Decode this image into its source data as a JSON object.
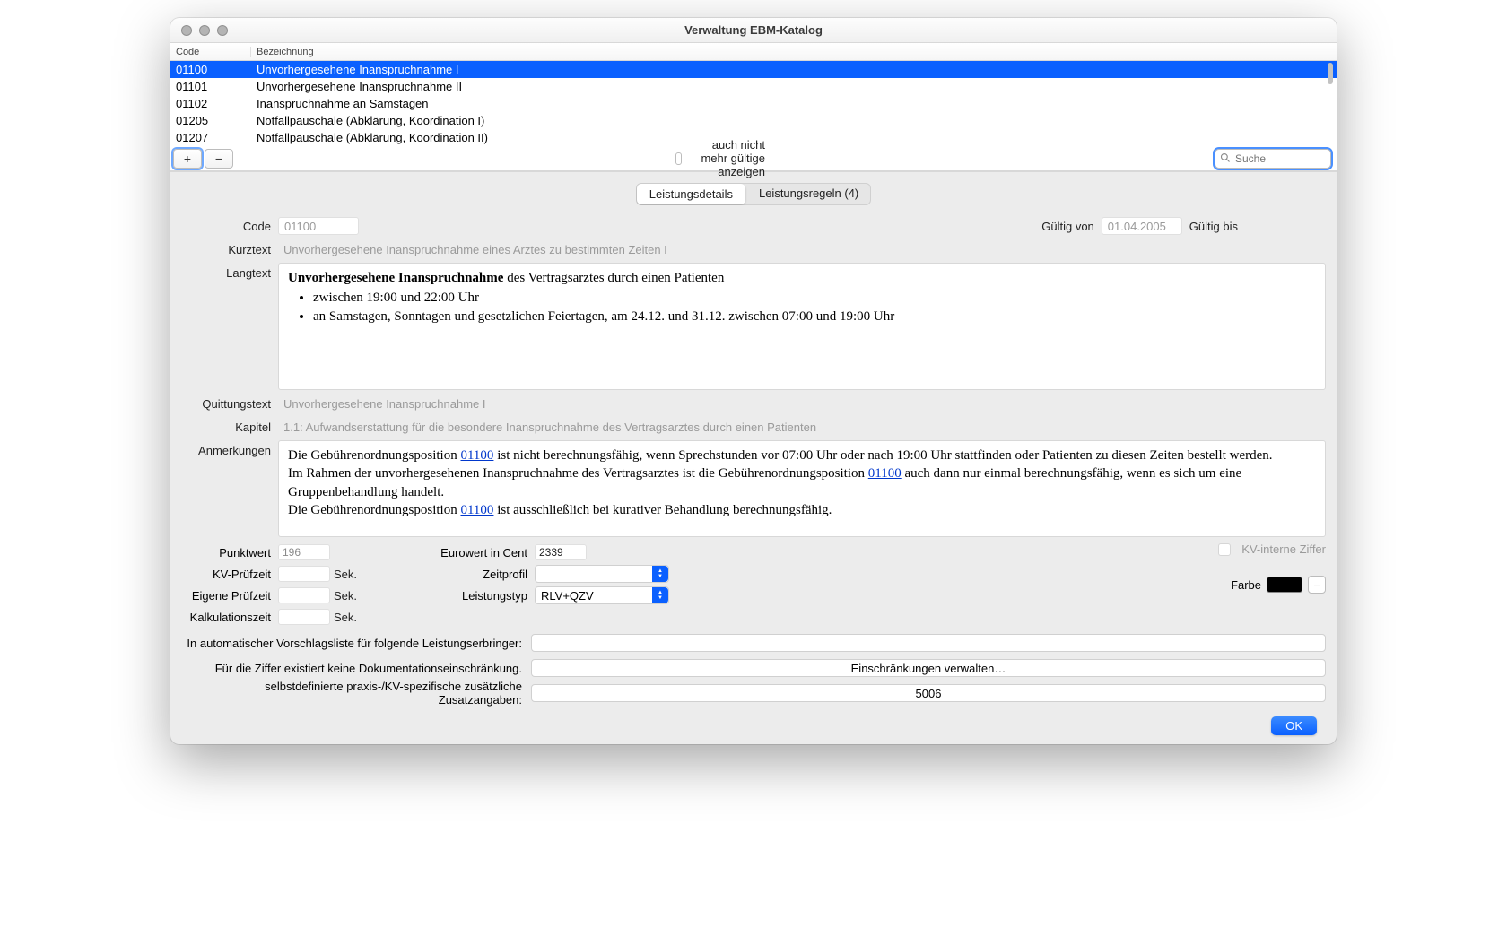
{
  "window": {
    "title": "Verwaltung EBM-Katalog"
  },
  "table": {
    "cols": {
      "code": "Code",
      "desc": "Bezeichnung"
    },
    "rows": [
      {
        "code": "01100",
        "desc": "Unvorhergesehene Inanspruchnahme I",
        "selected": true
      },
      {
        "code": "01101",
        "desc": "Unvorhergesehene Inanspruchnahme II"
      },
      {
        "code": "01102",
        "desc": "Inanspruchnahme an Samstagen"
      },
      {
        "code": "01205",
        "desc": "Notfallpauschale (Abklärung, Koordination I)"
      },
      {
        "code": "01207",
        "desc": "Notfallpauschale (Abklärung, Koordination II)"
      }
    ]
  },
  "toolbar": {
    "add": "+",
    "remove": "−",
    "also_invalid_label": "auch nicht mehr gültige anzeigen",
    "search_placeholder": "Suche"
  },
  "tabs": {
    "details": "Leistungsdetails",
    "rules": "Leistungsregeln (4)"
  },
  "details": {
    "labels": {
      "code": "Code",
      "valid_from": "Gültig von",
      "valid_to": "Gültig bis",
      "kurztext": "Kurztext",
      "langtext": "Langtext",
      "quittungstext": "Quittungstext",
      "kapitel": "Kapitel",
      "anmerkungen": "Anmerkungen",
      "punktwert": "Punktwert",
      "eurowert": "Eurowert in Cent",
      "kv_pruef": "KV-Prüfzeit",
      "eigene_pruef": "Eigene Prüfzeit",
      "kalk": "Kalkulationszeit",
      "zeitprofil": "Zeitprofil",
      "leistungstyp": "Leistungstyp",
      "kv_intern": "KV-interne Ziffer",
      "farbe": "Farbe",
      "sek": "Sek.",
      "auto_list": "In automatischer Vorschlagsliste für folgende Leistungserbringer:",
      "doc_restrict": "Für die Ziffer existiert keine Dokumentationseinschränkung.",
      "restrict_btn": "Einschränkungen verwalten…",
      "extra": "selbstdefinierte praxis-/KV-spezifische zusätzliche Zusatzangaben:"
    },
    "values": {
      "code": "01100",
      "valid_from": "01.04.2005",
      "valid_to": "",
      "kurztext": "Unvorhergesehene Inanspruchnahme eines Arztes zu bestimmten Zeiten I",
      "langtext_strong": "Unvorhergesehene Inanspruchnahme",
      "langtext_rest": " des Vertragsarztes durch einen Patienten",
      "langtext_b1": "zwischen 19:00 und 22:00 Uhr",
      "langtext_b2": "an Samstagen, Sonntagen und gesetzlichen Feiertagen, am 24.12. und 31.12. zwischen 07:00 und 19:00 Uhr",
      "quittungstext": "Unvorhergesehene Inanspruchnahme I",
      "kapitel": "1.1: Aufwandserstattung für die besondere Inanspruchnahme des Vertragsarztes durch einen Patienten",
      "anm_pre1": "Die Gebührenordnungsposition ",
      "anm_link": "01100",
      "anm_post1": " ist nicht berechnungsfähig, wenn Sprechstunden vor 07:00 Uhr oder nach 19:00 Uhr stattfinden oder Patienten zu diesen Zeiten bestellt werden.",
      "anm_pre2": "Im Rahmen der unvorhergesehenen Inanspruchnahme des Vertragsarztes ist die Gebührenordnungsposition ",
      "anm_post2": " auch dann nur einmal berechnungsfähig, wenn es sich um eine Gruppenbehandlung handelt.",
      "anm_pre3": "Die Gebührenordnungsposition ",
      "anm_post3": " ist ausschließlich bei kurativer Behandlung berechnungsfähig.",
      "punktwert": "196",
      "eurowert": "2339",
      "kv_pruef": "",
      "eigene_pruef": "",
      "kalk": "",
      "zeitprofil": "",
      "leistungstyp": "RLV+QZV",
      "farbe": "#000000",
      "extra_value": "5006"
    }
  },
  "footer": {
    "ok": "OK"
  }
}
